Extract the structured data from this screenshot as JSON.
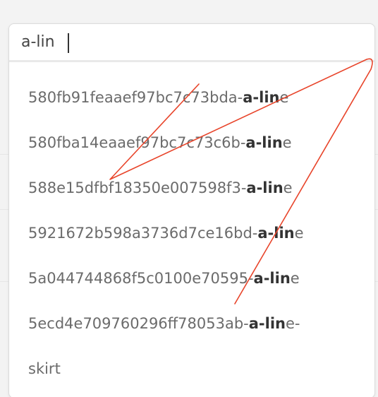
{
  "search": {
    "value": "a-lin"
  },
  "suggestions": [
    {
      "id": "580fb91feaaef97bc7c73bda",
      "sep": " - ",
      "match": "a-lin",
      "rest": "e"
    },
    {
      "id": "580fba14eaaef97bc7c73c6b",
      "sep": " - ",
      "match": "a-lin",
      "rest": "e"
    },
    {
      "id": "588e15dfbf18350e007598f3",
      "sep": " - ",
      "match": "a-lin",
      "rest": "e"
    },
    {
      "id": "5921672b598a3736d7ce16bd",
      "sep": " - ",
      "match": "a-lin",
      "rest": "e"
    },
    {
      "id": "5a044744868f5c0100e70595",
      "sep": " - ",
      "match": "a-lin",
      "rest": "e"
    },
    {
      "id": "5ecd4e709760296ff78053ab",
      "sep": " - ",
      "match": "a-lin",
      "rest": "e-",
      "wrap": "skirt"
    }
  ],
  "colors": {
    "annotation": "#e8442a",
    "match_text": "#333333",
    "muted_text": "#6b6b6b"
  }
}
